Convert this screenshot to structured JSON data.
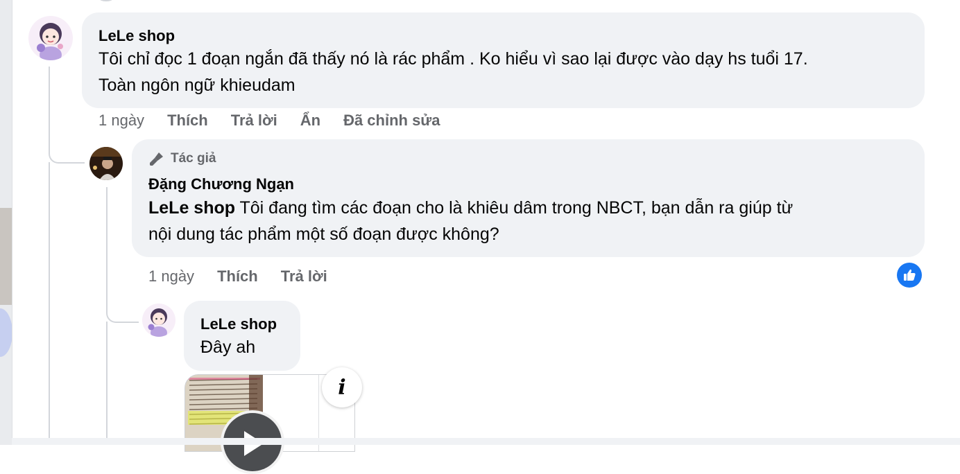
{
  "comments": [
    {
      "author": "LeLe shop",
      "text_line1": "Tôi chỉ đọc 1 đoạn ngắn đã thấy nó là rác phẩm . Ko hiểu vì sao lại được vào dạy hs tuổi 17.",
      "text_line2": "Toàn ngôn ngữ khieudam",
      "actions": {
        "time": "1 ngày",
        "like": "Thích",
        "reply": "Trả lời",
        "hide": "Ẩn",
        "edited": "Đã chỉnh sửa"
      }
    },
    {
      "badge": "Tác giả",
      "author": "Đặng Chương Ngạn",
      "mention": "LeLe shop",
      "text_line1": " Tôi đang tìm các đoạn cho là khiêu dâm trong NBCT, bạn dẫn ra giúp từ",
      "text_line2": "nội dung tác phẩm một số đoạn được không?",
      "actions": {
        "time": "1 ngày",
        "like": "Thích",
        "reply": "Trả lời"
      },
      "reaction_icon": "like-icon",
      "reaction_color": "#1877f2"
    },
    {
      "author": "LeLe shop",
      "text": "Đây ah",
      "attachment_icons": [
        "play-icon",
        "info-icon"
      ]
    }
  ],
  "info_glyph": "i",
  "colors": {
    "bubble": "#f0f2f5",
    "secondary_text": "#65676b",
    "accent": "#1877f2"
  }
}
